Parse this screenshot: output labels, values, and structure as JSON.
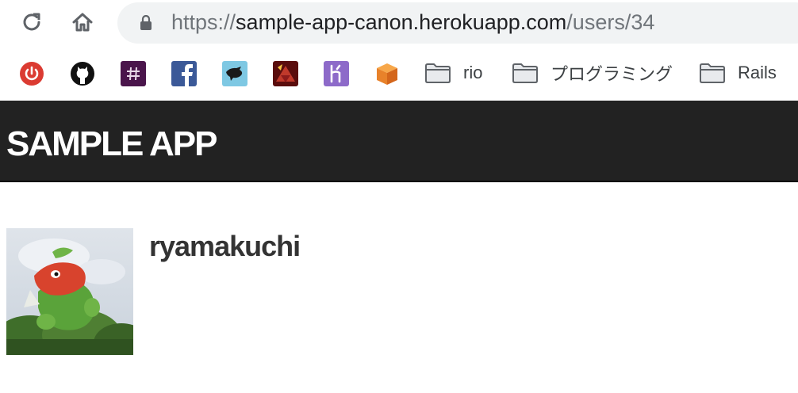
{
  "browser": {
    "url": {
      "scheme": "https://",
      "host": "sample-app-canon.herokuapp.com",
      "path": "/users/34"
    },
    "icons": {
      "reload": "reload-icon",
      "home": "home-icon",
      "lock": "lock-icon"
    }
  },
  "bookmarks": {
    "icons": [
      "power-icon",
      "github-icon",
      "slack-icon",
      "facebook-icon",
      "bird-icon",
      "ruby-icon",
      "heroku-icon",
      "box-icon"
    ],
    "folders": [
      {
        "label": "rio"
      },
      {
        "label": "プログラミング"
      },
      {
        "label": "Rails"
      }
    ]
  },
  "app": {
    "logo": "SAMPLE APP",
    "header_color": "#222222"
  },
  "profile": {
    "username": "ryamakuchi"
  }
}
